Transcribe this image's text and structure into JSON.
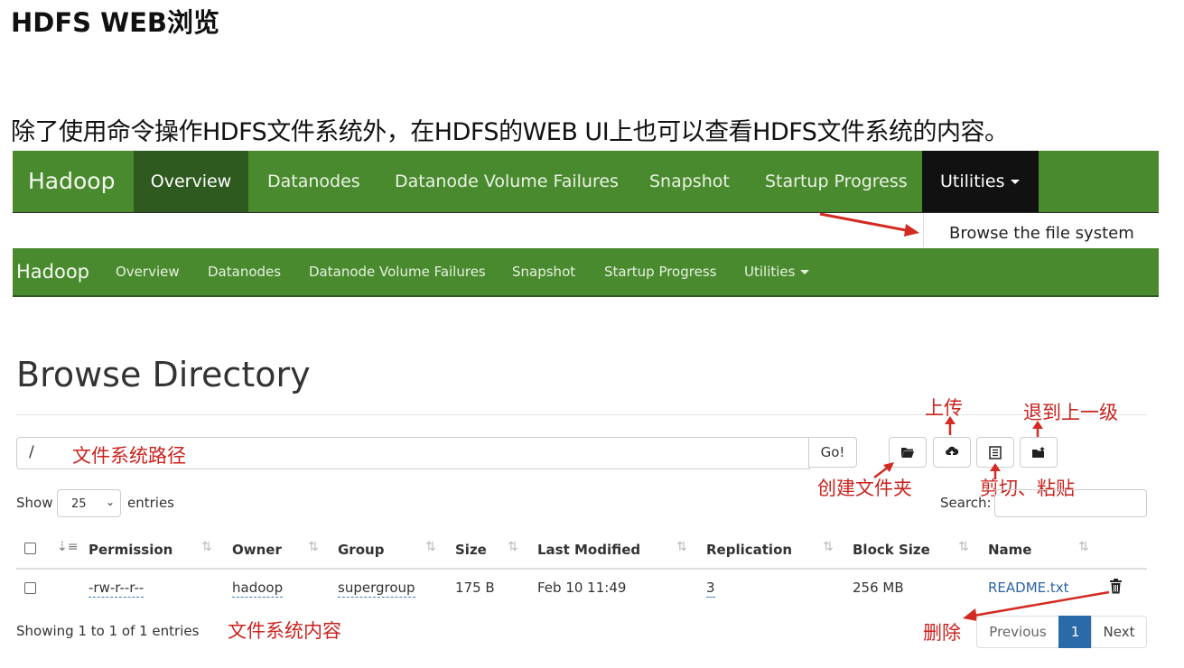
{
  "page": {
    "title": "HDFS WEB浏览",
    "intro": "除了使用命令操作HDFS文件系统外，在HDFS的WEB UI上也可以查看HDFS文件系统的内容。"
  },
  "navbar_top": {
    "brand": "Hadoop",
    "items": [
      "Overview",
      "Datanodes",
      "Datanode Volume Failures",
      "Snapshot",
      "Startup Progress",
      "Utilities"
    ],
    "active": "Overview",
    "dropdown_item": "Browse the file system"
  },
  "navbar_bottom": {
    "brand": "Hadoop",
    "items": [
      "Overview",
      "Datanodes",
      "Datanode Volume Failures",
      "Snapshot",
      "Startup Progress",
      "Utilities"
    ]
  },
  "browse": {
    "heading": "Browse Directory",
    "path_value": "/",
    "go_label": "Go!",
    "show_label": "Show",
    "entries_value": "25",
    "entries_label": "entries",
    "search_label": "Search:",
    "columns": [
      "Permission",
      "Owner",
      "Group",
      "Size",
      "Last Modified",
      "Replication",
      "Block Size",
      "Name"
    ],
    "rows": [
      {
        "permission": "-rw-r--r--",
        "owner": "hadoop",
        "group": "supergroup",
        "size": "175 B",
        "last_modified": "Feb 10 11:49",
        "replication": "3",
        "block_size": "256 MB",
        "name": "README.txt"
      }
    ],
    "footer_info": "Showing 1 to 1 of 1 entries",
    "pagination": {
      "previous": "Previous",
      "current": "1",
      "next": "Next"
    }
  },
  "annotations": {
    "path": "文件系统路径",
    "upload": "上传",
    "go_up": "退到上一级",
    "mkdir": "创建文件夹",
    "cut_paste": "剪切、粘贴",
    "contents": "文件系统内容",
    "delete": "删除"
  },
  "colors": {
    "navbar_green": "#4a8a2f",
    "active_green": "#2f5a1f",
    "annotation_red": "#c8231e",
    "page_active_blue": "#2a6aa8"
  },
  "icons": {
    "toolbar": [
      "folder-open-icon",
      "cloud-upload-icon",
      "list-icon",
      "folder-up-icon"
    ],
    "delete": "trash-icon"
  }
}
